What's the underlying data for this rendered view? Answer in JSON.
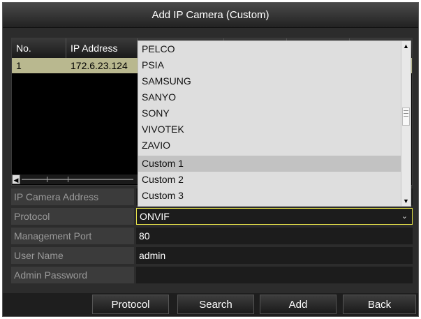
{
  "dialog": {
    "title": "Add IP Camera (Custom)"
  },
  "table": {
    "headers": [
      "No.",
      "IP Address"
    ],
    "rows": [
      {
        "no": "1",
        "ip": "172.6.23.124"
      }
    ]
  },
  "form": {
    "ip_camera_address_label": "IP Camera Address",
    "protocol_label": "Protocol",
    "protocol_value": "ONVIF",
    "management_port_label": "Management Port",
    "management_port_value": "80",
    "user_name_label": "User Name",
    "user_name_value": "admin",
    "admin_password_label": "Admin Password"
  },
  "dropdown": {
    "options": [
      "PELCO",
      "PSIA",
      "SAMSUNG",
      "SANYO",
      "SONY",
      "VIVOTEK",
      "ZAVIO",
      "Custom 1",
      "Custom 2",
      "Custom 3"
    ],
    "highlighted": "Custom 1"
  },
  "footer": {
    "protocol_label": "Protocol",
    "search_label": "Search",
    "add_label": "Add",
    "back_label": "Back"
  },
  "icons": {
    "scroll_left": "chevron-left-icon",
    "scroll_up": "chevron-up-icon",
    "scroll_down": "chevron-down-icon",
    "select_arrow": "chevron-down-icon"
  },
  "colors": {
    "selected_row": "#b9b88f",
    "focus_border": "#e6e24a",
    "dropdown_bg": "#dedede",
    "highlight_item": "#c2c2c2"
  }
}
